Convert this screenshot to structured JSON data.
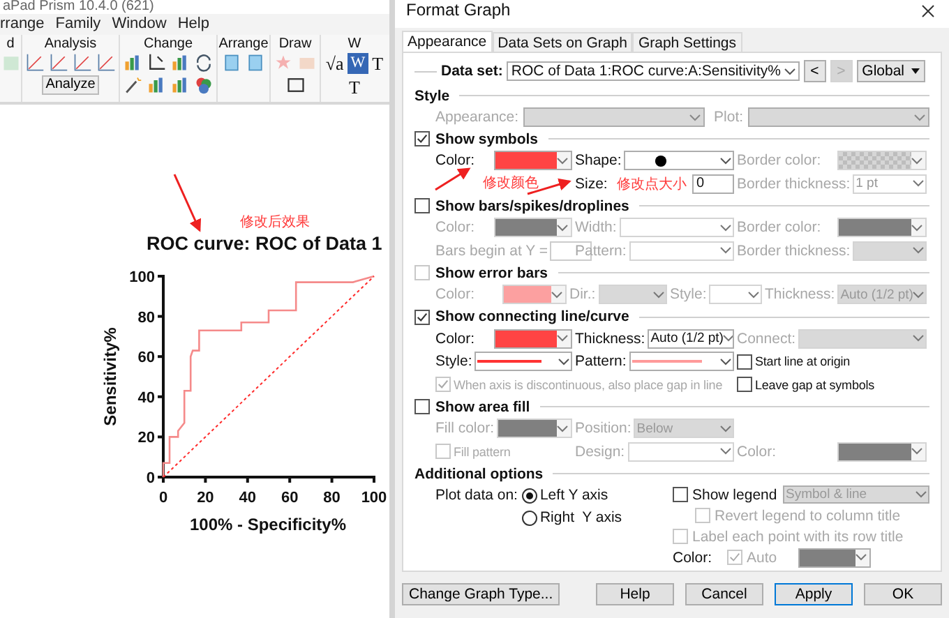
{
  "app": {
    "title": "aPad Prism 10.4.0 (621)",
    "menu": [
      "rrange",
      "Family",
      "Window",
      "Help"
    ],
    "ribbon": [
      {
        "label": "d"
      },
      {
        "label": "Analysis",
        "button": "Analyze"
      },
      {
        "label": "Change"
      },
      {
        "label": "Arrange"
      },
      {
        "label": "Draw"
      },
      {
        "label": "W",
        "glyphs": [
          "√a",
          "W",
          "T",
          "T"
        ]
      }
    ]
  },
  "graph": {
    "chart_data": {
      "type": "line",
      "title": "ROC curve: ROC of Data 1",
      "xlabel": "100% - Specificity%",
      "ylabel": "Sensitivity%",
      "x": [
        0,
        0,
        3,
        3,
        7,
        7,
        10,
        10,
        13,
        13,
        14,
        17,
        17,
        37,
        37,
        50,
        50,
        63,
        63,
        90,
        100
      ],
      "series": [
        {
          "color": "#f58a8a",
          "line_style": "solid",
          "values": [
            0,
            7,
            7,
            20,
            20,
            23,
            27,
            43,
            43,
            60,
            63,
            63,
            73,
            73,
            77,
            77,
            83,
            83,
            97,
            97,
            100
          ]
        },
        {
          "color": "#ff2a2a",
          "line_style": "dashed",
          "values": [
            0,
            0,
            3,
            3,
            7,
            7,
            10,
            10,
            13,
            13,
            14,
            17,
            17,
            37,
            37,
            50,
            50,
            63,
            63,
            90,
            100
          ]
        }
      ],
      "xlim": [
        0,
        100
      ],
      "ylim": [
        0,
        100
      ],
      "xticks": [
        0,
        20,
        40,
        60,
        80,
        100
      ],
      "yticks": [
        0,
        20,
        40,
        60,
        80,
        100
      ]
    }
  },
  "dialog": {
    "title": "Format Graph",
    "tabs": [
      {
        "label": "Appearance",
        "selected": true
      },
      {
        "label": "Data Sets on Graph",
        "selected": false
      },
      {
        "label": "Graph Settings",
        "selected": false
      }
    ],
    "data_set": {
      "label": "Data set:",
      "value": "ROC of Data 1:ROC curve:A:Sensitivity%",
      "prev": "<",
      "next": ">",
      "next_disabled": true,
      "scope": "Global"
    },
    "style": {
      "heading": "Style",
      "fields": [
        {
          "label": "Appearance:",
          "disabled": true
        },
        {
          "label": "Plot:",
          "disabled": true
        }
      ]
    },
    "sections": [
      {
        "label": "Show symbols",
        "checked": true,
        "disabled": false,
        "rows": [
          [
            {
              "kind": "color",
              "label": "Color:",
              "color": "#ff4444",
              "disabled": false
            },
            {
              "kind": "shape",
              "label": "Shape:",
              "disabled": false
            },
            {
              "kind": "checker",
              "label": "Border color:",
              "disabled": true
            }
          ],
          [
            "",
            {
              "kind": "input",
              "label": "Size:",
              "value": "0",
              "disabled": false
            },
            {
              "kind": "select",
              "label": "Border thickness:",
              "value": "1 pt",
              "disabled": true
            }
          ]
        ]
      },
      {
        "label": "Show bars/spikes/droplines",
        "checked": false,
        "disabled": false,
        "rows": [
          [
            {
              "kind": "color",
              "label": "Color:",
              "color": "#808080",
              "disabled": true
            },
            {
              "kind": "select",
              "label": "Width:",
              "disabled": true
            },
            {
              "kind": "color",
              "label": "Border color:",
              "color": "#808080",
              "disabled": true
            }
          ],
          [
            {
              "kind": "input",
              "label": "Bars begin at Y =",
              "disabled": true
            },
            {
              "kind": "select",
              "label": "Pattern:",
              "disabled": true
            },
            {
              "kind": "select",
              "label": "Border thickness:",
              "disabled": true,
              "filled": true
            }
          ]
        ]
      },
      {
        "label": "Show error bars",
        "checked": false,
        "disabled": true,
        "rows": [
          [
            {
              "kind": "color",
              "label": "Color:",
              "color": "#fca0a0",
              "disabled": true
            },
            {
              "kind": "select",
              "label": "Dir.:",
              "disabled": true,
              "filled": true
            },
            {
              "kind": "select",
              "label": "Style:",
              "disabled": true
            },
            {
              "kind": "select",
              "label": "Thickness:",
              "value": "Auto (1/2 pt)",
              "disabled": true,
              "filled": true
            }
          ]
        ]
      },
      {
        "label": "Show connecting line/curve",
        "checked": true,
        "disabled": false,
        "rows": [
          [
            {
              "kind": "color",
              "label": "Color:",
              "color": "#ff4444",
              "disabled": false
            },
            {
              "kind": "select",
              "label": "Thickness:",
              "value": "Auto (1/2 pt)",
              "disabled": false
            },
            {
              "kind": "select",
              "label": "Connect:",
              "disabled": true,
              "filled": true
            }
          ],
          [
            {
              "kind": "line",
              "label": "Style:",
              "color": "#ff3333",
              "disabled": false
            },
            {
              "kind": "line",
              "label": "Pattern:",
              "color": "#ff9a9a",
              "disabled": false
            },
            {
              "kind": "check",
              "label": "Start line at origin",
              "checked": false,
              "disabled": false
            }
          ],
          [
            {
              "kind": "check",
              "label": "When axis is discontinuous, also place gap in line",
              "checked": true,
              "disabled": true
            },
            "",
            {
              "kind": "check",
              "label": "Leave gap at symbols",
              "checked": false,
              "disabled": false
            }
          ]
        ]
      },
      {
        "label": "Show area fill",
        "checked": false,
        "disabled": false,
        "rows": [
          [
            {
              "kind": "color",
              "label": "Fill color:",
              "color": "#808080",
              "disabled": true
            },
            {
              "kind": "select",
              "label": "Position:",
              "value": "Below",
              "disabled": true,
              "filled": true
            }
          ],
          [
            {
              "kind": "check",
              "label": "Fill pattern",
              "checked": false,
              "disabled": true
            },
            {
              "kind": "select",
              "label": "Design:",
              "disabled": true
            },
            {
              "kind": "color",
              "label": "Color:",
              "color": "#808080",
              "disabled": true
            }
          ]
        ]
      }
    ],
    "additional": {
      "heading": "Additional options",
      "plot_label": "Plot data on:",
      "axes": [
        {
          "label": "Left Y axis",
          "selected": true
        },
        {
          "label": "Right  Y axis",
          "selected": false
        }
      ],
      "show_legend": {
        "label": "Show legend",
        "checked": false,
        "value": "Symbol & line"
      },
      "revert": {
        "label": "Revert legend to column title",
        "checked": false,
        "disabled": true
      },
      "label_points": {
        "label": "Label each point with its row title",
        "checked": false,
        "disabled": true
      },
      "color_label": "Color:",
      "auto": {
        "label": "Auto",
        "checked": true,
        "disabled": true
      },
      "color": "#808080"
    },
    "buttons": [
      {
        "label": "Change Graph Type...",
        "default": false
      },
      {
        "label": "Help",
        "default": false
      },
      {
        "label": "Cancel",
        "default": false
      },
      {
        "label": "Apply",
        "default": true
      },
      {
        "label": "OK",
        "default": false
      }
    ]
  },
  "annotations": [
    {
      "text": "修改后效果"
    },
    {
      "text": "修改颜色"
    },
    {
      "text": "修改点大小"
    }
  ]
}
